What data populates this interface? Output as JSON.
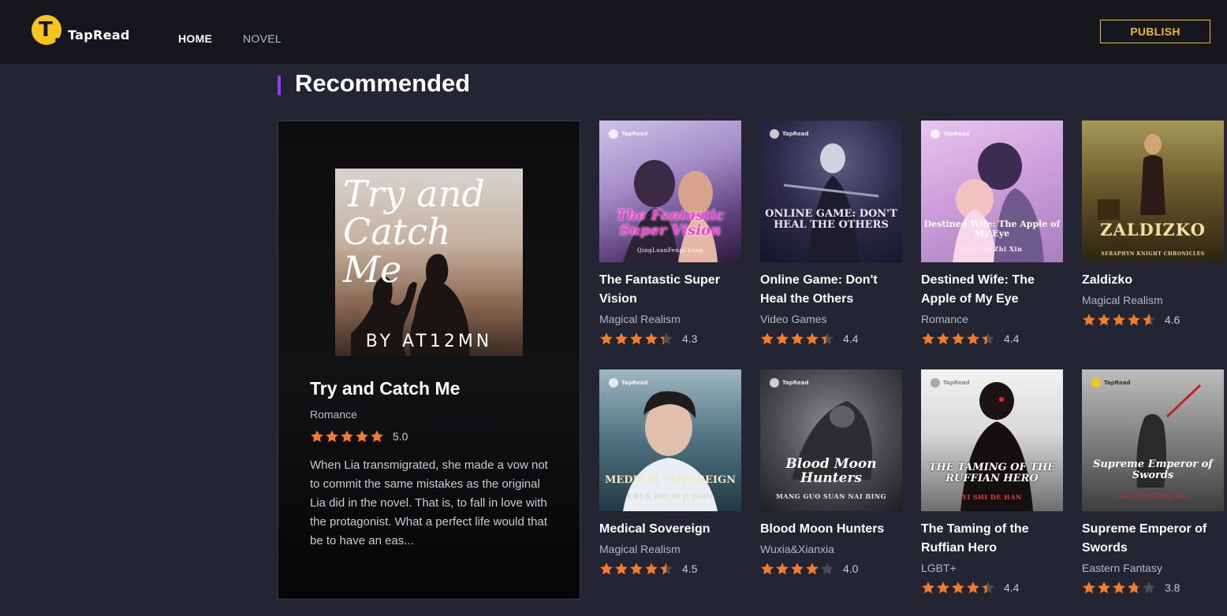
{
  "header": {
    "logo_text": "TapRead",
    "nav": [
      {
        "label": "HOME",
        "active": true
      },
      {
        "label": "NOVEL",
        "active": false
      }
    ],
    "publish_label": "PUBLISH"
  },
  "section": {
    "title": "Recommended",
    "accent_color": "#8f3bff"
  },
  "featured": {
    "cover_title": "Try and Catch Me",
    "cover_author": "BY AT12MN",
    "title": "Try and Catch Me",
    "genre": "Romance",
    "rating": 5.0,
    "rating_text": "5.0",
    "description": "When Lia transmigrated, she made a vow not to commit the same mistakes as the original Lia did in the novel. That is, to fall in love with the protagonist. What a perfect life would that be to have an eas..."
  },
  "books": [
    {
      "title": "The Fantastic Super Vision",
      "genre": "Magical Realism",
      "rating": 4.3,
      "rating_text": "4.3",
      "cover_title": "The Fantastic Super Vision",
      "cover_author": "QingLuanFengChang"
    },
    {
      "title": "Online Game: Don't Heal the Others",
      "genre": "Video Games",
      "rating": 4.4,
      "rating_text": "4.4",
      "cover_title": "ONLINE GAME: DON'T HEAL THE OTHERS",
      "cover_author": ""
    },
    {
      "title": "Destined Wife: The Apple of My Eye",
      "genre": "Romance",
      "rating": 4.4,
      "rating_text": "4.4",
      "cover_title": "Destined Wife: The Apple of My Eye",
      "cover_author": "Yao Yao Zhi Xin"
    },
    {
      "title": "Zaldizko",
      "genre": "Magical Realism",
      "rating": 4.6,
      "rating_text": "4.6",
      "cover_title": "ZALDIZKO",
      "cover_author": "SERAPHYN KNIGHT CHRONICLES"
    },
    {
      "title": "Medical Sovereign",
      "genre": "Magical Realism",
      "rating": 4.5,
      "rating_text": "4.5",
      "cover_title": "MEDICAL SOVEREIGN",
      "cover_author": "CHUN HEI SI JI DIAN"
    },
    {
      "title": "Blood Moon Hunters",
      "genre": "Wuxia&Xianxia",
      "rating": 4.0,
      "rating_text": "4.0",
      "cover_title": "Blood Moon Hunters",
      "cover_author": "MANG GUO SUAN NAI BING"
    },
    {
      "title": "The Taming of the Ruffian Hero",
      "genre": "LGBT+",
      "rating": 4.4,
      "rating_text": "4.4",
      "cover_title": "THE TAMING OF THE RUFFIAN HERO",
      "cover_author": "YI SHI DE HAN"
    },
    {
      "title": "Supreme Emperor of Swords",
      "genre": "Eastern Fantasy",
      "rating": 3.8,
      "rating_text": "3.8",
      "cover_title": "Supreme Emperor of Swords",
      "cover_author": "Luan Shi Kuang Dao"
    }
  ],
  "colors": {
    "star": "#f47b2a",
    "star_empty": "#4a4c55",
    "publish": "#f5b81a",
    "logo": "#f8c51c"
  }
}
